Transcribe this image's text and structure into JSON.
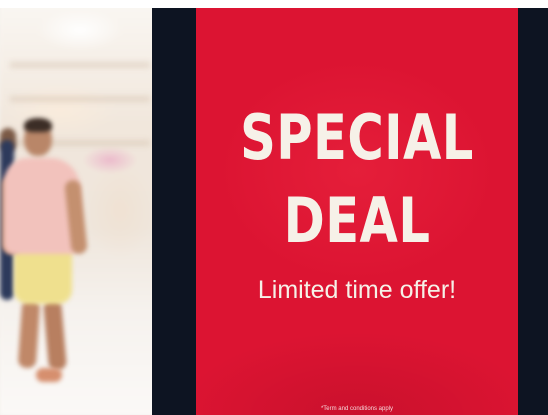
{
  "sign": {
    "headline_line1": "SPECIAL",
    "headline_line2": "DEAL",
    "subline": "Limited time offer!",
    "fineprint": "*Term and conditions apply",
    "panel_color": "#dc1432",
    "frame_color": "#0d1422",
    "text_color": "#f6f1e8"
  }
}
